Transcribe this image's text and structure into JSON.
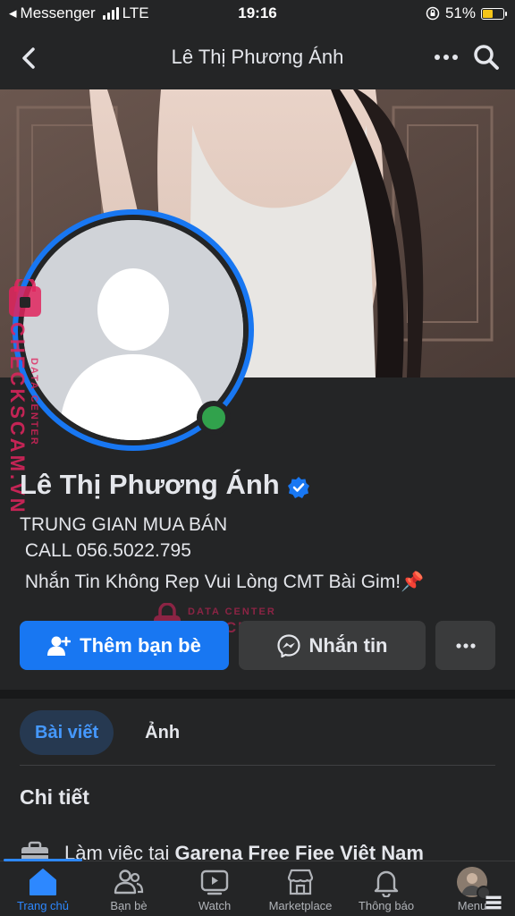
{
  "status_bar": {
    "carrier": "Messenger",
    "network": "LTE",
    "time": "19:16",
    "battery": "51%"
  },
  "header": {
    "title": "Lê Thị Phương Ánh",
    "back_icon": "chevron-left-icon",
    "more_icon": "more-horizontal-icon",
    "search_icon": "search-icon"
  },
  "profile": {
    "name": "Lê Thị Phương Ánh",
    "verified": true,
    "online": true,
    "bio_lines": [
      "TRUNG GIAN MUA BÁN",
      " CALL 056.5022.795",
      " Nhắn Tin Không Rep Vui Lòng CMT Bài Gim!"
    ],
    "bio_pin": "📌"
  },
  "actions": {
    "add_friend": "Thêm bạn bè",
    "message": "Nhắn tin"
  },
  "tabs": [
    {
      "label": "Bài viết",
      "active": true
    },
    {
      "label": "Ảnh",
      "active": false
    }
  ],
  "details": {
    "title": "Chi tiết",
    "work_prefix": "Làm việc tai ",
    "work_place": "Garena Free Fiee Việt Nam"
  },
  "watermark": {
    "line1": "DATA CENTER",
    "line2": "CHECKSCAM.VN"
  },
  "bottom_nav": [
    {
      "label": "Trang chủ",
      "icon": "home-icon",
      "active": true
    },
    {
      "label": "Bạn bè",
      "icon": "friends-icon",
      "active": false
    },
    {
      "label": "Watch",
      "icon": "watch-icon",
      "active": false
    },
    {
      "label": "Marketplace",
      "icon": "marketplace-icon",
      "active": false
    },
    {
      "label": "Thông báo",
      "icon": "bell-icon",
      "active": false
    },
    {
      "label": "Menu",
      "icon": "menu-avatar",
      "active": false
    }
  ],
  "colors": {
    "background": "#242526",
    "primary": "#1877f2",
    "online": "#31a24c",
    "accent_text": "#4599ff"
  }
}
